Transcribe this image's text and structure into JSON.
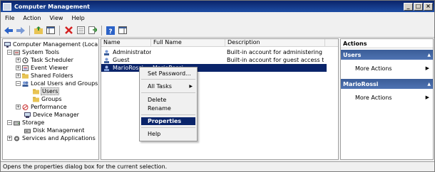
{
  "window": {
    "title": "Computer Management",
    "controls": [
      "_",
      "□",
      "×"
    ]
  },
  "menubar": [
    "File",
    "Action",
    "View",
    "Help"
  ],
  "toolbar": [
    "back",
    "forward",
    "up",
    "show-hide-tree",
    "delete",
    "properties",
    "export",
    "help",
    "show-hide-action"
  ],
  "tree": {
    "root": "Computer Management (Local)",
    "system_tools": "System Tools",
    "task_scheduler": "Task Scheduler",
    "event_viewer": "Event Viewer",
    "shared_folders": "Shared Folders",
    "local_users_groups": "Local Users and Groups",
    "users": "Users",
    "groups": "Groups",
    "performance": "Performance",
    "device_manager": "Device Manager",
    "storage": "Storage",
    "disk_management": "Disk Management",
    "services_apps": "Services and Applications"
  },
  "list": {
    "columns": [
      "Name",
      "Full Name",
      "Description"
    ],
    "rows": [
      {
        "name": "Administrator",
        "full_name": "",
        "description": "Built-in account for administering the..."
      },
      {
        "name": "Guest",
        "full_name": "",
        "description": "Built-in account for guest access to t..."
      },
      {
        "name": "MarioRossi",
        "full_name": "MarioRossi",
        "description": ""
      }
    ]
  },
  "context_menu": {
    "set_password": "Set Password...",
    "all_tasks": "All Tasks",
    "delete": "Delete",
    "rename": "Rename",
    "properties": "Properties",
    "help": "Help"
  },
  "actions": {
    "title": "Actions",
    "section1": "Users",
    "section1_link": "More Actions",
    "section2": "MarioRossi",
    "section2_link": "More Actions"
  },
  "statusbar": "Opens the properties dialog box for the current selection.",
  "colors": {
    "selection": "#0a246a",
    "action_header": "#3b5d98"
  }
}
